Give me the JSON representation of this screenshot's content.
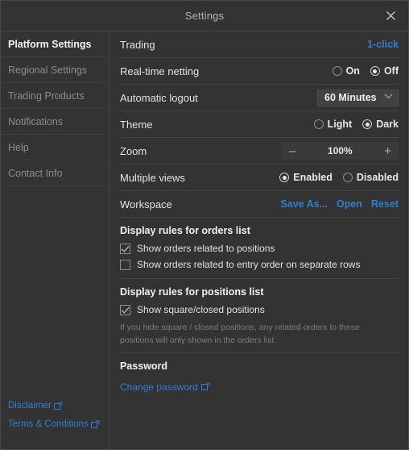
{
  "window": {
    "title": "Settings",
    "close_icon": "close-icon"
  },
  "sidebar": {
    "items": [
      {
        "label": "Platform Settings",
        "active": true
      },
      {
        "label": "Regional Settings",
        "active": false
      },
      {
        "label": "Trading Products",
        "active": false
      },
      {
        "label": "Notifications",
        "active": false
      },
      {
        "label": "Help",
        "active": false
      },
      {
        "label": "Contact Info",
        "active": false
      }
    ],
    "links": [
      {
        "label": "Disclaimer",
        "icon": "external-link-icon"
      },
      {
        "label": "Terms & Conditions",
        "icon": "external-link-icon"
      }
    ]
  },
  "main": {
    "trading": {
      "label": "Trading",
      "action": "1-click"
    },
    "netting": {
      "label": "Real-time netting",
      "options": [
        "On",
        "Off"
      ],
      "selected": "Off"
    },
    "logout": {
      "label": "Automatic logout",
      "value": "60 Minutes",
      "chevron": "chevron-down-icon"
    },
    "theme": {
      "label": "Theme",
      "options": [
        "Light",
        "Dark"
      ],
      "selected": "Dark"
    },
    "zoom": {
      "label": "Zoom",
      "minus": "–",
      "value": "100%",
      "plus": "+"
    },
    "multiple_views": {
      "label": "Multiple views",
      "options": [
        "Enabled",
        "Disabled"
      ],
      "selected": "Enabled"
    },
    "workspace": {
      "label": "Workspace",
      "actions": [
        "Save As...",
        "Open",
        "Reset"
      ]
    },
    "orders_rules": {
      "title": "Display rules for orders list",
      "items": [
        {
          "label": "Show orders related to positions",
          "checked": true
        },
        {
          "label": "Show orders related to entry order on separate rows",
          "checked": false
        }
      ]
    },
    "positions_rules": {
      "title": "Display rules for positions list",
      "items": [
        {
          "label": "Show square/closed positions",
          "checked": true
        }
      ],
      "note": "If you hide square / closed positions, any related orders to these positions will only shown in the orders list."
    },
    "password": {
      "title": "Password",
      "link": "Change password",
      "icon": "external-link-icon"
    }
  },
  "colors": {
    "accent_link": "#2f7fd0",
    "panel_bg": "#333333",
    "divider": "#434343",
    "text_primary": "#e3e3e3",
    "text_muted": "#8c8c8c"
  }
}
